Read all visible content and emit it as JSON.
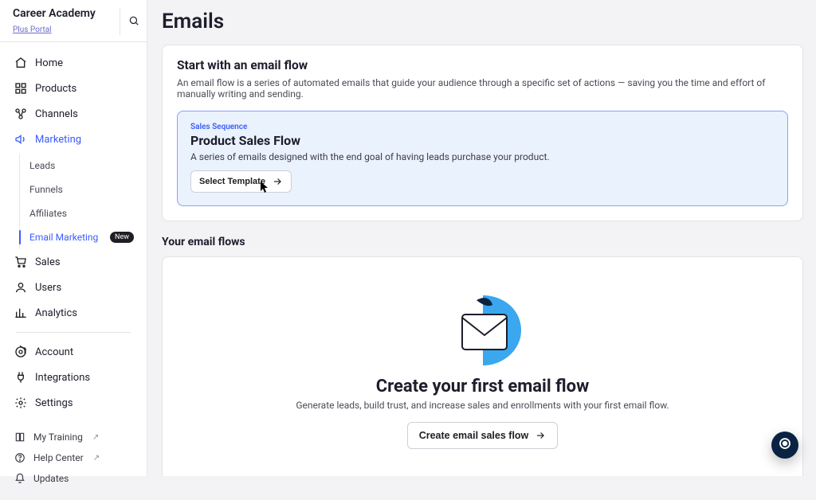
{
  "brand": {
    "title": "Career Academy",
    "subtitle": "Plus Portal"
  },
  "nav": {
    "items": [
      {
        "label": "Home"
      },
      {
        "label": "Products"
      },
      {
        "label": "Channels"
      },
      {
        "label": "Marketing"
      },
      {
        "label": "Sales"
      },
      {
        "label": "Users"
      },
      {
        "label": "Analytics"
      },
      {
        "label": "Account"
      },
      {
        "label": "Integrations"
      },
      {
        "label": "Settings"
      }
    ],
    "marketing_sub": [
      {
        "label": "Leads"
      },
      {
        "label": "Funnels"
      },
      {
        "label": "Affiliates"
      },
      {
        "label": "Email Marketing",
        "badge": "New"
      }
    ]
  },
  "bottom_nav": {
    "items": [
      {
        "label": "My Training"
      },
      {
        "label": "Help Center"
      },
      {
        "label": "Updates"
      }
    ],
    "ext": "↗"
  },
  "page": {
    "title": "Emails",
    "start": {
      "title": "Start with an email flow",
      "desc": "An email flow is a series of automated emails that guide your audience through a specific set of actions — saving you the time and effort of manually writing and sending."
    },
    "flow": {
      "eyebrow": "Sales Sequence",
      "title": "Product Sales Flow",
      "desc": "A series of emails designed with the end goal of having leads purchase your product.",
      "button": "Select Template"
    },
    "list": {
      "title": "Your email flows",
      "empty_title": "Create your first email flow",
      "empty_desc": "Generate leads, build trust, and increase sales and enrollments with your first email flow.",
      "cta": "Create email sales flow"
    }
  }
}
